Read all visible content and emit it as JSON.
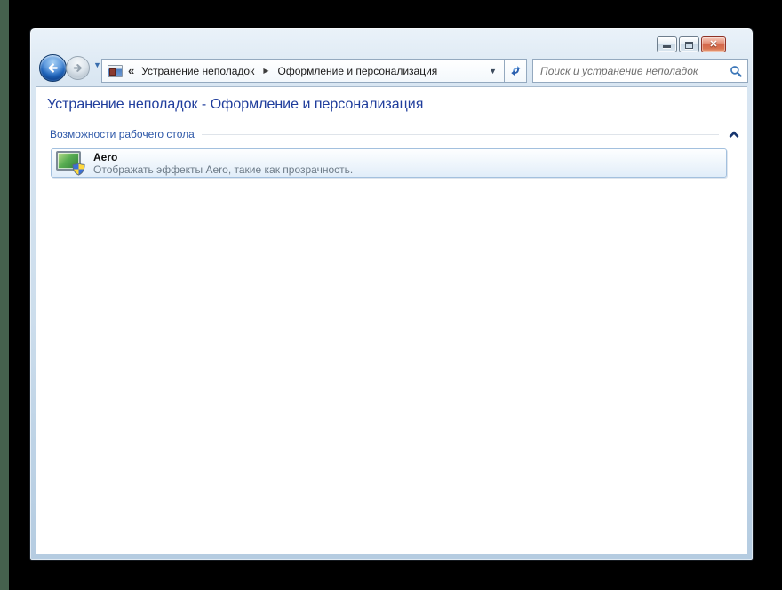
{
  "icons": {
    "close_glyph": "✕",
    "breadcrumb_overflow": "«",
    "breadcrumb_separator": "▶",
    "breadcrumb_dropdown": "▼",
    "nav_history_dropdown": "▼"
  },
  "navbar": {
    "breadcrumbs": [
      {
        "label": "Устранение неполадок"
      },
      {
        "label": "Оформление и персонализация"
      }
    ],
    "search_placeholder": "Поиск и устранение неполадок"
  },
  "content": {
    "heading": "Устранение неполадок - Оформление и персонализация",
    "sections": [
      {
        "title": "Возможности рабочего стола",
        "items": [
          {
            "title": "Aero",
            "description": "Отображать эффекты Aero, такие как прозрачность."
          }
        ]
      }
    ]
  },
  "colors": {
    "heading_text": "#1f3d9c",
    "section_text": "#2e58a8",
    "item_description": "#6d7b88",
    "glass_top": "#eaf2f9",
    "glass_bottom": "#b5cce1",
    "close_button": "#d3664a",
    "accent_blue": "#2a5fae",
    "wallpaper_strip": "#45614d"
  }
}
